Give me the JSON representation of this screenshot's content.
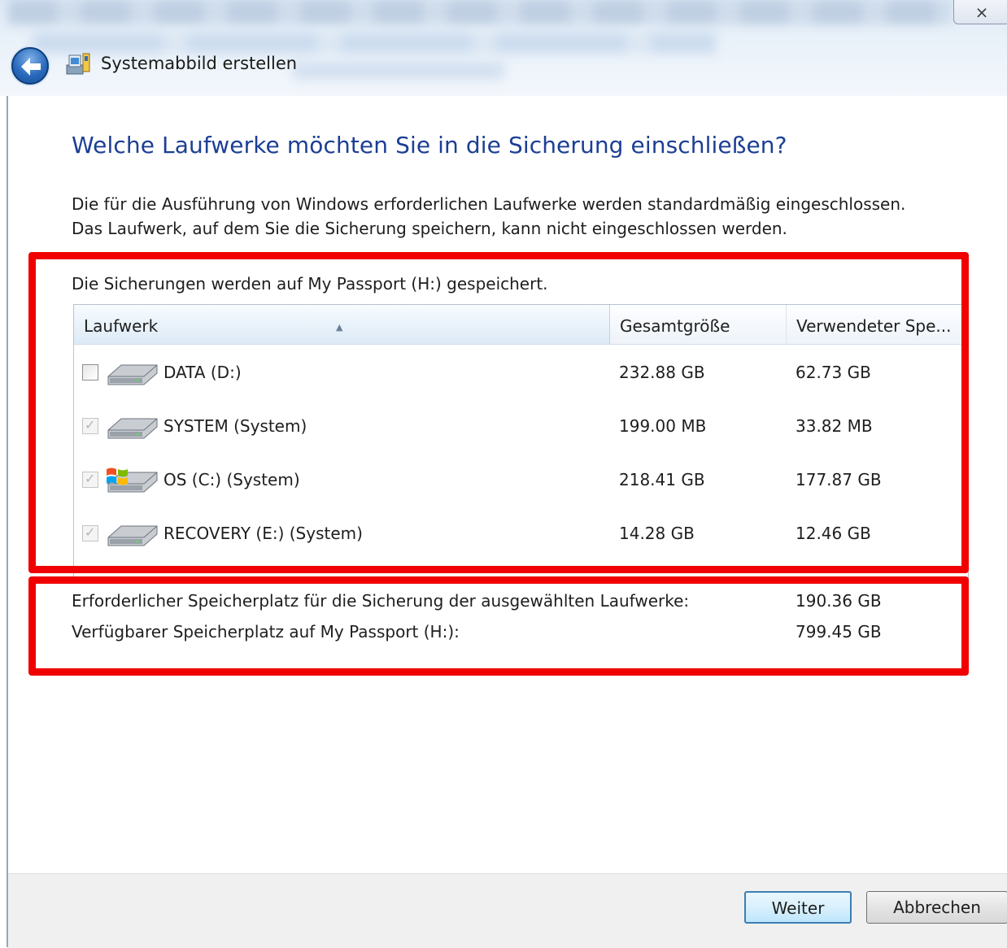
{
  "window": {
    "title": "Systemabbild erstellen",
    "close_glyph": "⨯"
  },
  "page": {
    "heading": "Welche Laufwerke möchten Sie in die Sicherung einschließen?",
    "description_line1": "Die für die Ausführung von Windows erforderlichen Laufwerke werden standardmäßig eingeschlossen.",
    "description_line2": "Das Laufwerk, auf dem Sie die Sicherung speichern, kann nicht eingeschlossen werden.",
    "save_location": "Die Sicherungen werden auf My Passport (H:) gespeichert."
  },
  "table": {
    "columns": [
      "Laufwerk",
      "Gesamtgröße",
      "Verwendeter Spe..."
    ],
    "sort_indicator": "▲",
    "rows": [
      {
        "name": "DATA (D:)",
        "total": "232.88 GB",
        "used": "62.73 GB",
        "checked": false,
        "icon": "hard-drive-icon"
      },
      {
        "name": "SYSTEM (System)",
        "total": "199.00 MB",
        "used": "33.82 MB",
        "checked": true,
        "icon": "hard-drive-icon"
      },
      {
        "name": "OS (C:) (System)",
        "total": "218.41 GB",
        "used": "177.87 GB",
        "checked": true,
        "icon": "windows-drive-icon"
      },
      {
        "name": "RECOVERY (E:) (System)",
        "total": "14.28 GB",
        "used": "12.46 GB",
        "checked": true,
        "icon": "hard-drive-icon"
      }
    ]
  },
  "summary": {
    "required_label": "Erforderlicher Speicherplatz für die Sicherung der ausgewählten Laufwerke:",
    "required_value": "190.36 GB",
    "available_label": "Verfügbarer Speicherplatz auf My Passport (H:):",
    "available_value": "799.45 GB"
  },
  "buttons": {
    "next": "Weiter",
    "cancel": "Abbrechen"
  },
  "colors": {
    "heading": "#1c3f94",
    "annotation": "#f00000"
  }
}
